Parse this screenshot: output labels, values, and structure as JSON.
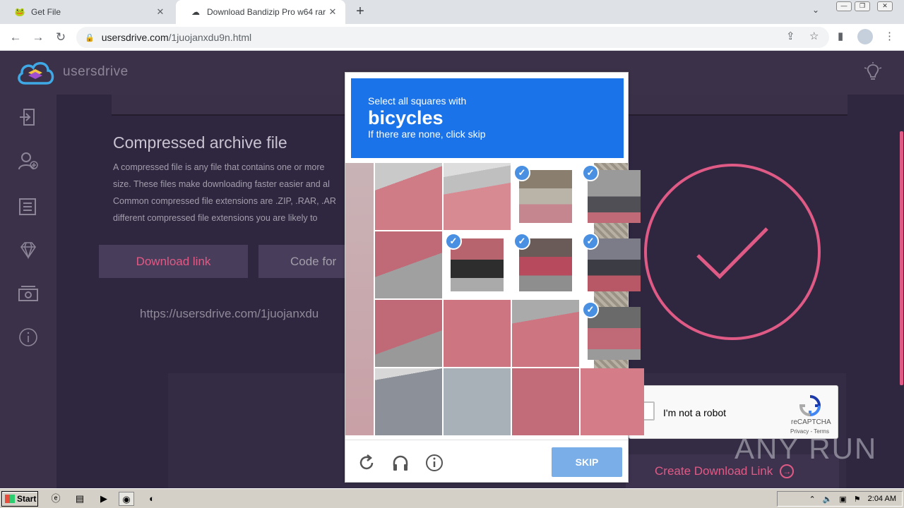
{
  "browser": {
    "tabs": [
      {
        "title": "Get File"
      },
      {
        "title": "Download Bandizip Pro w64 rar"
      }
    ],
    "url_domain": "usersdrive.com",
    "url_path": "/1juojanxdu9n.html"
  },
  "site": {
    "brand": "usersdrive",
    "heading": "Compressed archive file",
    "paragraph_lines": [
      "A compressed file is any file that contains one or more",
      "size. These files make downloading faster easier and al",
      "Common compressed file extensions are .ZIP, .RAR, .AR",
      "different compressed file extensions you are likely to"
    ],
    "download_link_label": "Download link",
    "code_for_label": "Code for",
    "file_url": "https://usersdrive.com/1juojanxdu",
    "create_link_label": "Create Download Link",
    "accent_color": "#e05a86"
  },
  "recaptcha_anchor": {
    "label": "I'm not a robot",
    "brand": "reCAPTCHA",
    "links": "Privacy - Terms"
  },
  "challenge": {
    "instruction": "Select all squares with",
    "target": "bicycles",
    "hint": "If there are none, click skip",
    "skip_label": "SKIP",
    "selected_tiles": [
      2,
      3,
      5,
      6,
      7,
      11
    ]
  },
  "watermark": "ANY RUN",
  "taskbar": {
    "start_label": "Start",
    "clock": "2:04 AM"
  }
}
